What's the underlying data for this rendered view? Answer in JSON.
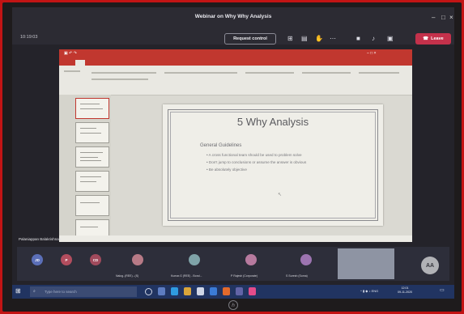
{
  "window": {
    "title": "Webinar on Why Why Analysis",
    "timer": "10:19:03"
  },
  "toolbar": {
    "request_control_label": "Request control",
    "leave_label": "Leave",
    "icons": [
      "camera-icon",
      "chat-icon",
      "raise-hand-icon",
      "more-icon",
      "video-icon",
      "mic-icon",
      "share-icon",
      "phone-icon"
    ]
  },
  "slide": {
    "title": "5 Why Analysis",
    "subtitle": "General Guidelines",
    "bullets": [
      "A cross functional team should be used to problem solve",
      "Don't jump to conclusions or assume the answer is obvious",
      "Be absolutely objective"
    ]
  },
  "participants": {
    "presenter": "Palaniappan Balakrishnan",
    "initials": [
      "JD",
      "P",
      "CD",
      "",
      "",
      "",
      "",
      ""
    ],
    "names": [
      "",
      "",
      "",
      "Nalog..(REE)...(S)",
      "Kumar.G (REE) - Bond...",
      "P Rajesh (Corporate)",
      "S Suresh (Soma)",
      ""
    ],
    "self_initials": "AA"
  },
  "taskbar": {
    "search_placeholder": "Type here to search",
    "time": "12:01",
    "date": "09-11-2020"
  },
  "colors": {
    "leave": "#c4314b",
    "ppt_red": "#c1372f",
    "taskbar": "#213461"
  }
}
